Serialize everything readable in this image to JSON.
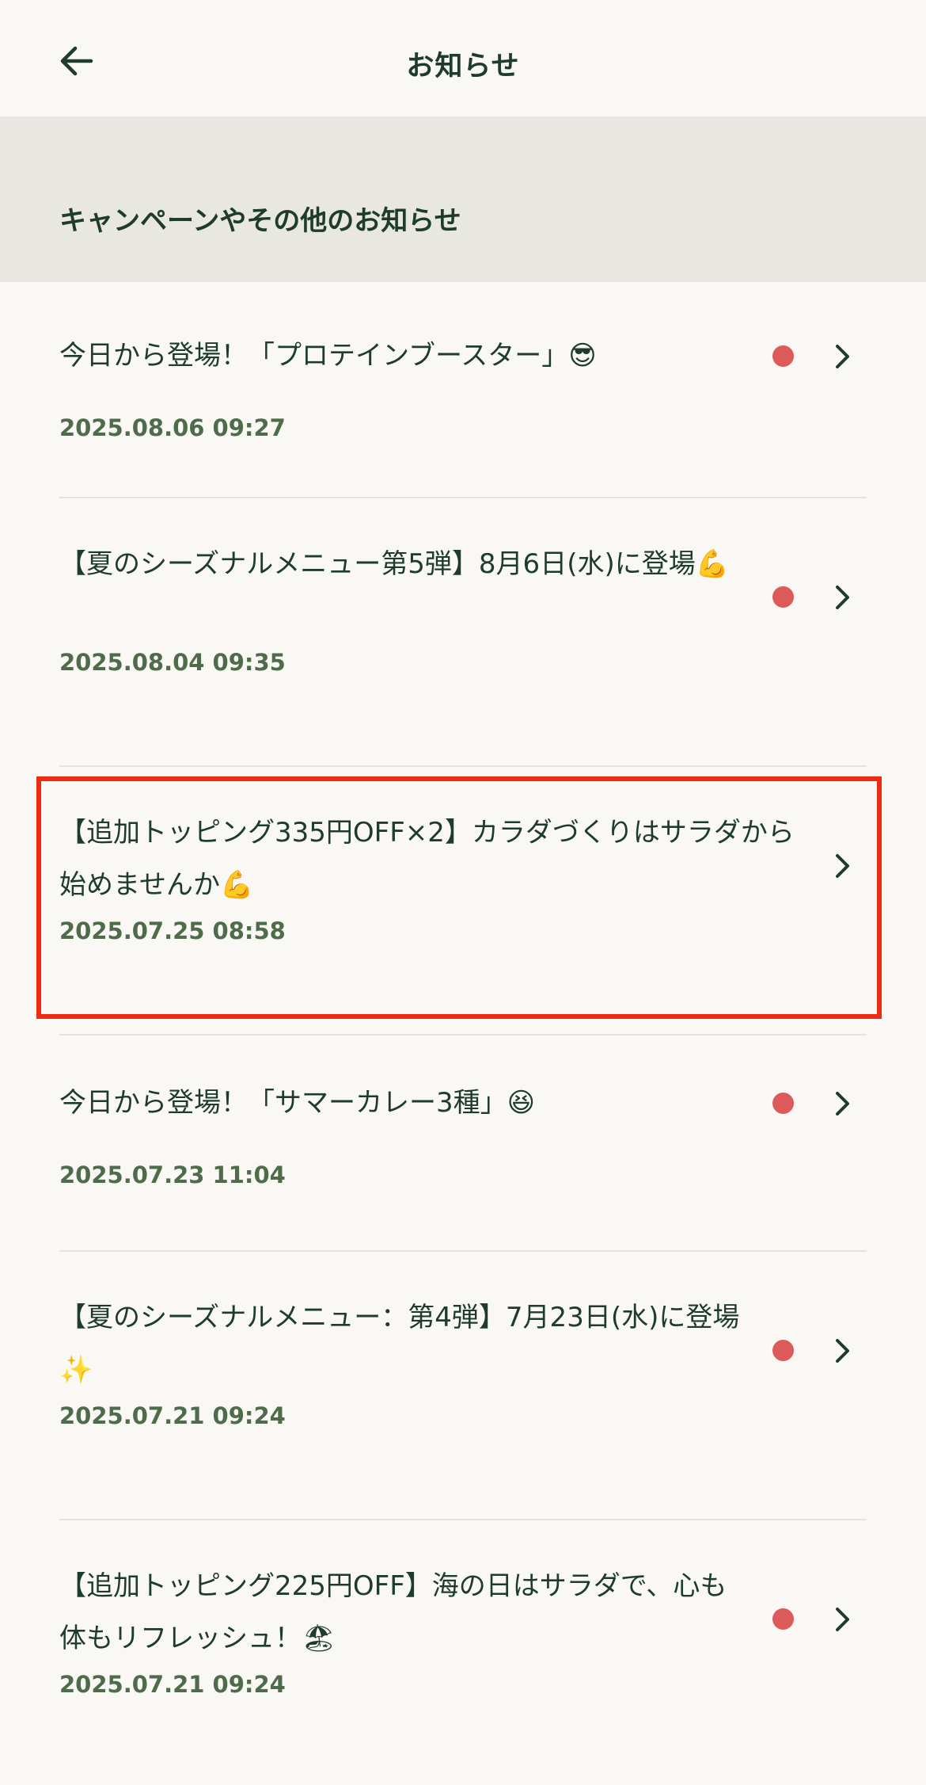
{
  "header": {
    "title": "お知らせ",
    "back_icon": "arrow-left-icon"
  },
  "section": {
    "title": "キャンペーンやその他のお知らせ"
  },
  "colors": {
    "background": "#f9f8f4",
    "section_bg": "#e8e7e2",
    "text": "#1e3b2c",
    "date_text": "#4e6b4a",
    "unread_dot": "#dc5a5a",
    "highlight": "#ee2a12"
  },
  "notifications": [
    {
      "title": "今日から登場！「プロテインブースター」😎",
      "date": "2025.08.06 09:27",
      "unread": true
    },
    {
      "title": "【夏のシーズナルメニュー第5弾】8月6日(水)に登場💪",
      "date": "2025.08.04 09:35",
      "unread": true
    },
    {
      "title": "【追加トッピング335円OFF×2】カラダづくりはサラダから始めませんか💪",
      "date": "2025.07.25 08:58",
      "unread": false
    },
    {
      "title": "今日から登場！「サマーカレー3種」😆",
      "date": "2025.07.23 11:04",
      "unread": true
    },
    {
      "title": "【夏のシーズナルメニュー：第4弾】7月23日(水)に登場✨",
      "date": "2025.07.21 09:24",
      "unread": true
    },
    {
      "title": "【追加トッピング225円OFF】海の日はサラダで、心も体もリフレッシュ！🏖",
      "date": "2025.07.21 09:24",
      "unread": true
    }
  ]
}
